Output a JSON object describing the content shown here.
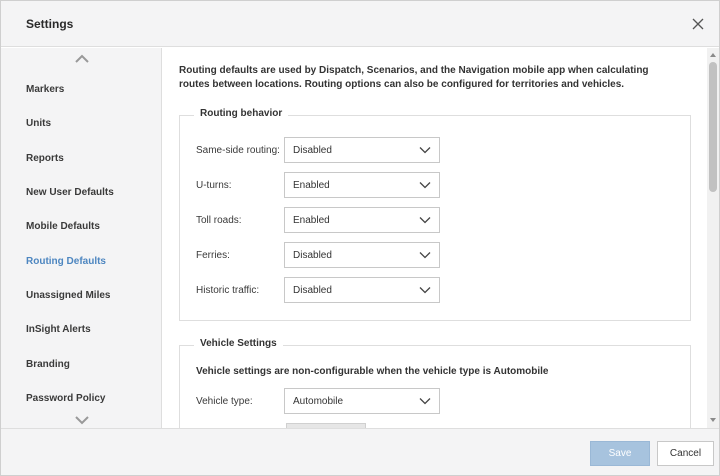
{
  "header": {
    "title": "Settings",
    "close_icon": "close-icon"
  },
  "sidebar": {
    "items": [
      {
        "label": "Markers",
        "active": false
      },
      {
        "label": "Units",
        "active": false
      },
      {
        "label": "Reports",
        "active": false
      },
      {
        "label": "New User Defaults",
        "active": false
      },
      {
        "label": "Mobile Defaults",
        "active": false
      },
      {
        "label": "Routing Defaults",
        "active": true
      },
      {
        "label": "Unassigned Miles",
        "active": false
      },
      {
        "label": "InSight Alerts",
        "active": false
      },
      {
        "label": "Branding",
        "active": false
      },
      {
        "label": "Password Policy",
        "active": false
      }
    ],
    "active_color": "#4d86c0"
  },
  "main": {
    "intro": "Routing defaults are used by Dispatch, Scenarios, and the Navigation mobile app when calculating routes between locations. Routing options can also be configured for territories and vehicles.",
    "routing_behavior": {
      "legend": "Routing behavior",
      "rows": [
        {
          "label": "Same-side routing:",
          "value": "Disabled"
        },
        {
          "label": "U-turns:",
          "value": "Enabled"
        },
        {
          "label": "Toll roads:",
          "value": "Enabled"
        },
        {
          "label": "Ferries:",
          "value": "Disabled"
        },
        {
          "label": "Historic traffic:",
          "value": "Disabled"
        }
      ]
    },
    "vehicle_settings": {
      "legend": "Vehicle Settings",
      "note": "Vehicle settings are non-configurable when the vehicle type is Automobile",
      "vehicle_type_label": "Vehicle type:",
      "vehicle_type_value": "Automobile"
    }
  },
  "footer": {
    "save_label": "Save",
    "cancel_label": "Cancel"
  }
}
